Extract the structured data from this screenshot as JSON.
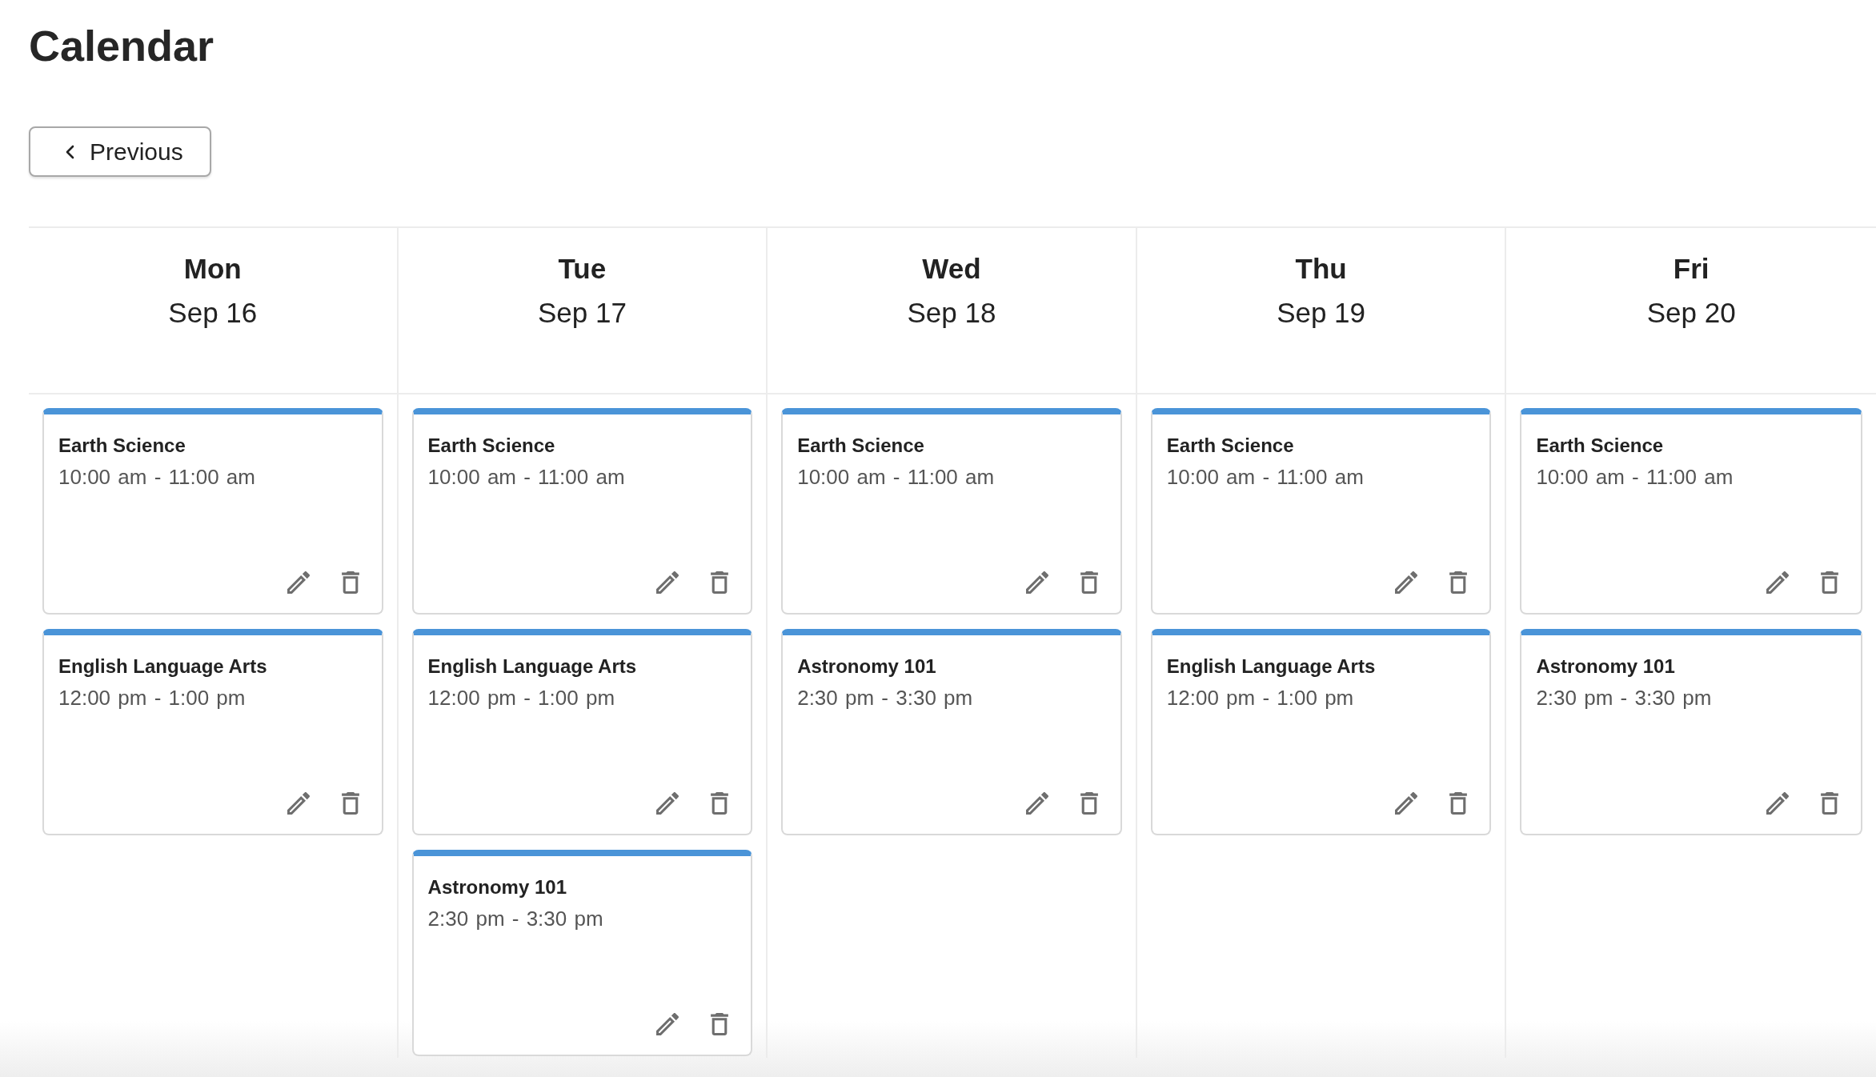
{
  "title": "Calendar",
  "previous_button": {
    "label": "Previous"
  },
  "days": [
    {
      "weekday": "Mon",
      "date": "Sep 16",
      "events": [
        {
          "title": "Earth Science",
          "time": "10:00 am - 11:00 am"
        },
        {
          "title": "English Language Arts",
          "time": "12:00 pm - 1:00 pm"
        }
      ]
    },
    {
      "weekday": "Tue",
      "date": "Sep 17",
      "events": [
        {
          "title": "Earth Science",
          "time": "10:00 am - 11:00 am"
        },
        {
          "title": "English Language Arts",
          "time": "12:00 pm - 1:00 pm"
        },
        {
          "title": "Astronomy 101",
          "time": "2:30 pm - 3:30 pm"
        }
      ]
    },
    {
      "weekday": "Wed",
      "date": "Sep 18",
      "events": [
        {
          "title": "Earth Science",
          "time": "10:00 am - 11:00 am"
        },
        {
          "title": "Astronomy 101",
          "time": "2:30 pm - 3:30 pm"
        }
      ]
    },
    {
      "weekday": "Thu",
      "date": "Sep 19",
      "events": [
        {
          "title": "Earth Science",
          "time": "10:00 am - 11:00 am"
        },
        {
          "title": "English Language Arts",
          "time": "12:00 pm - 1:00 pm"
        }
      ]
    },
    {
      "weekday": "Fri",
      "date": "Sep 20",
      "events": [
        {
          "title": "Earth Science",
          "time": "10:00 am - 11:00 am"
        },
        {
          "title": "Astronomy 101",
          "time": "2:30 pm - 3:30 pm"
        }
      ]
    }
  ]
}
